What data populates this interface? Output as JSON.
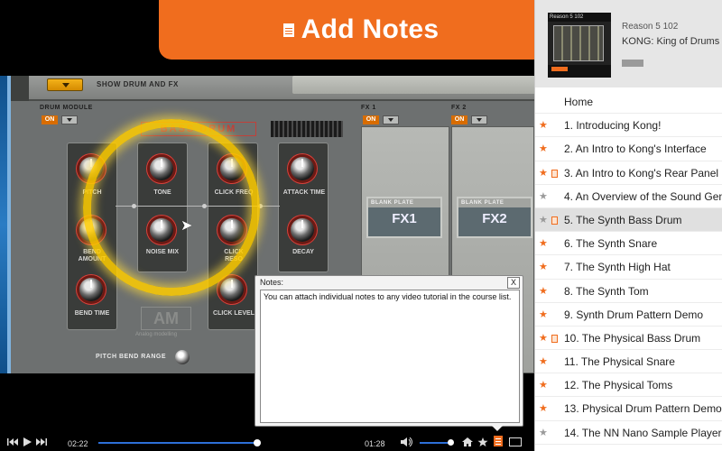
{
  "banner": {
    "title": "Add Notes",
    "icon": "note-icon"
  },
  "video": {
    "show_drum_fx": "SHOW DRUM AND FX",
    "drum_module_label": "DRUM MODULE",
    "on_label": "ON",
    "bass_drum_title": "BASS DRUM",
    "fx1_label": "FX 1",
    "fx2_label": "FX 2",
    "knobs": {
      "pitch": "PITCH",
      "tone": "TONE",
      "click_freq": "CLICK FREQ",
      "attack_time": "ATTACK TIME",
      "bend_amount": "BEND AMOUNT",
      "noise_mix": "NOISE MIX",
      "click_reso": "CLICK RESO",
      "decay": "DECAY",
      "bend_time": "BEND TIME",
      "click_level": "CLICK LEVEL"
    },
    "am_logo": "AM",
    "am_sub": "Analog modelling",
    "pitch_bend_range": "PITCH BEND RANGE",
    "blank_plate": "BLANK PLATE",
    "fx1_plate": "FX1",
    "fx2_plate": "FX2"
  },
  "notes": {
    "label": "Notes:",
    "close": "X",
    "text": "You can attach individual notes to any video tutorial in the course list."
  },
  "controls": {
    "elapsed": "02:22",
    "remaining": "01:28",
    "seek_progress": 0.8,
    "volume_level": 0.9
  },
  "sidebar": {
    "course_code": "Reason 5 102",
    "course_title": "KONG: King of Drums",
    "thumb_caption": "Reason 5 102",
    "home": "Home",
    "lessons": [
      {
        "label": "1.  Introducing Kong!",
        "star": "orange",
        "note": false,
        "selected": false
      },
      {
        "label": "2.  An Intro to Kong's Interface",
        "star": "orange",
        "note": false,
        "selected": false
      },
      {
        "label": "3.  An Intro to Kong's Rear Panel",
        "star": "orange",
        "note": true,
        "selected": false
      },
      {
        "label": "4.  An Overview of the Sound Gen",
        "star": "grey",
        "note": false,
        "selected": false
      },
      {
        "label": "5.  The Synth Bass Drum",
        "star": "grey",
        "note": true,
        "selected": true
      },
      {
        "label": "6.  The Synth Snare",
        "star": "orange",
        "note": false,
        "selected": false
      },
      {
        "label": "7.  The Synth High Hat",
        "star": "orange",
        "note": false,
        "selected": false
      },
      {
        "label": "8.  The Synth Tom",
        "star": "orange",
        "note": false,
        "selected": false
      },
      {
        "label": "9.  Synth Drum Pattern Demo",
        "star": "orange",
        "note": false,
        "selected": false
      },
      {
        "label": "10. The Physical Bass Drum",
        "star": "orange",
        "note": true,
        "selected": false
      },
      {
        "label": "11. The Physical Snare",
        "star": "orange",
        "note": false,
        "selected": false
      },
      {
        "label": "12. The Physical Toms",
        "star": "orange",
        "note": false,
        "selected": false
      },
      {
        "label": "13. Physical Drum Pattern Demo",
        "star": "orange",
        "note": false,
        "selected": false
      },
      {
        "label": "14. The NN Nano Sample Player",
        "star": "grey",
        "note": false,
        "selected": false
      }
    ]
  },
  "colors": {
    "accent": "#f06d1e",
    "progress": "#2d6fd8"
  }
}
